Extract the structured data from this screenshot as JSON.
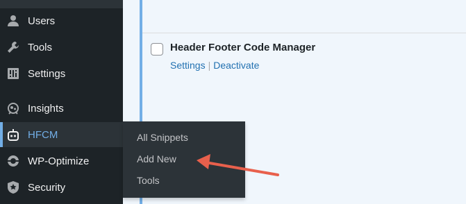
{
  "sidebar": {
    "items": [
      {
        "label": "Users",
        "icon": "user-icon"
      },
      {
        "label": "Tools",
        "icon": "wrench-icon"
      },
      {
        "label": "Settings",
        "icon": "settings-sliders-icon"
      },
      {
        "label": "Insights",
        "icon": "insights-icon"
      },
      {
        "label": "HFCM",
        "icon": "robot-icon"
      },
      {
        "label": "WP-Optimize",
        "icon": "wp-optimize-icon"
      },
      {
        "label": "Security",
        "icon": "shield-icon"
      }
    ],
    "active": "HFCM"
  },
  "flyout": {
    "items": [
      {
        "label": "All Snippets"
      },
      {
        "label": "Add New"
      },
      {
        "label": "Tools"
      }
    ]
  },
  "plugin": {
    "title": "Header Footer Code Manager",
    "actions": [
      {
        "label": "Settings"
      },
      {
        "label": "Deactivate"
      }
    ],
    "separator": "|"
  },
  "colors": {
    "sidebar_bg": "#1d2327",
    "active_text": "#72aee6",
    "link": "#2271b1",
    "annotation_arrow": "#e8604c"
  }
}
